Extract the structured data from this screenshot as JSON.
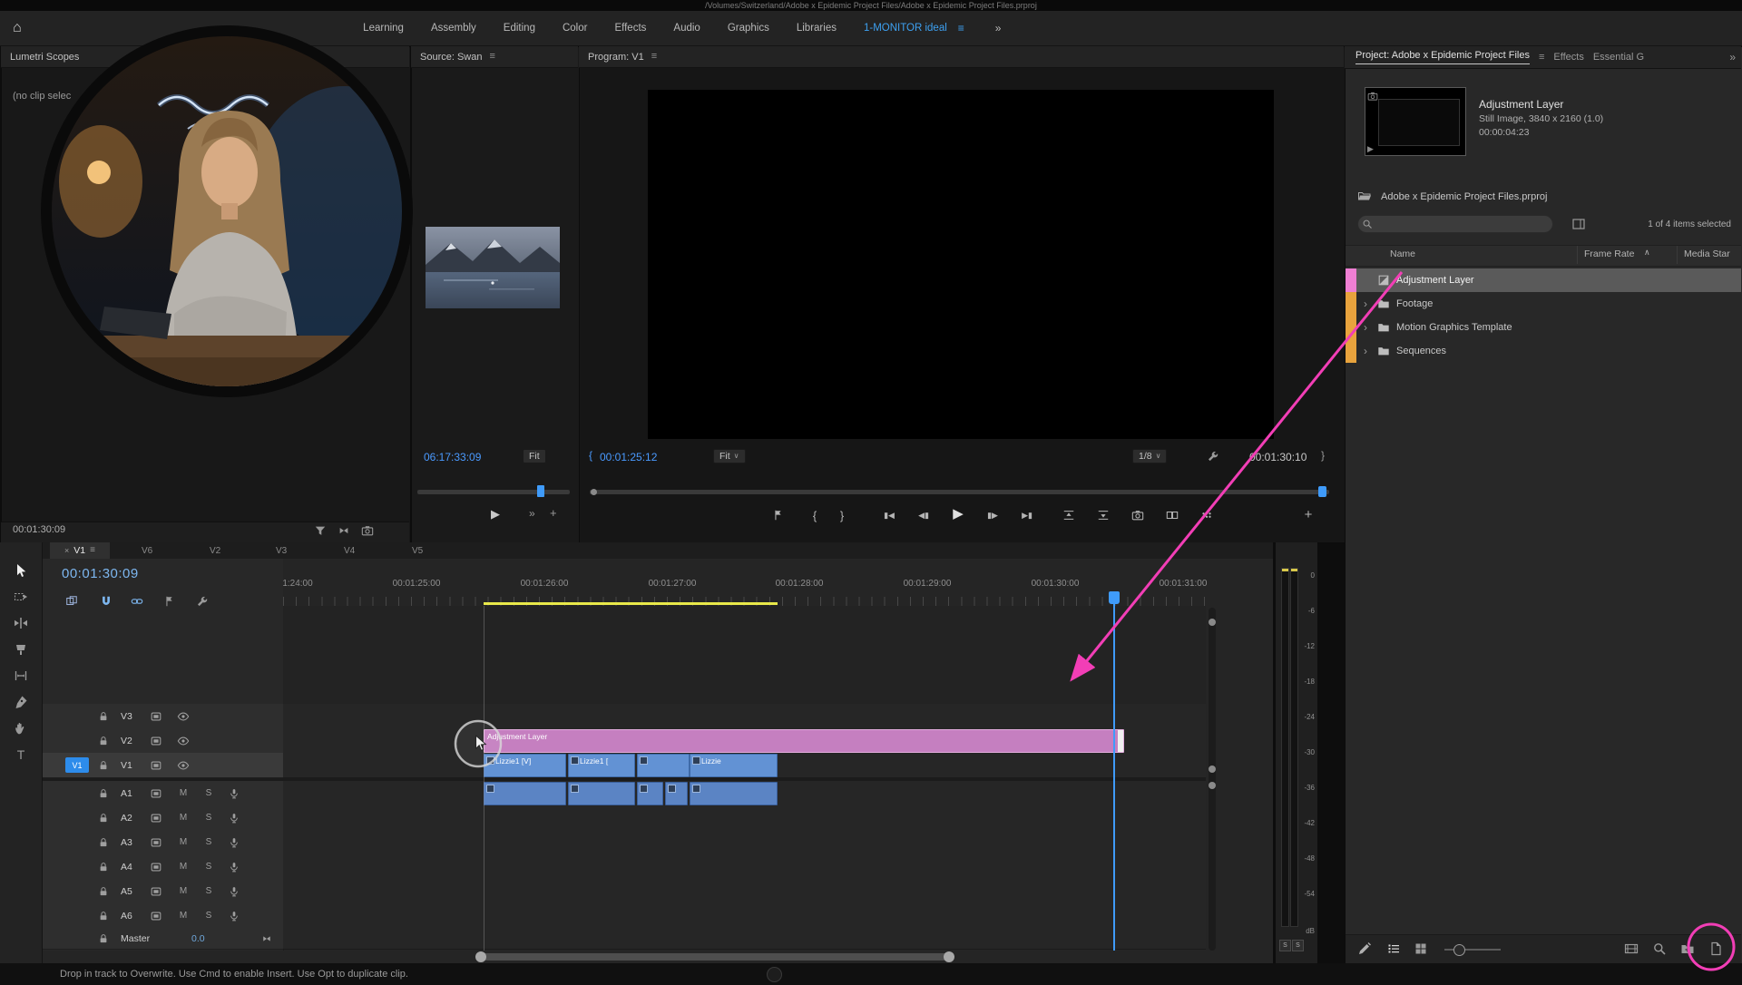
{
  "colors": {
    "accent_blue": "#3da0f0",
    "timecode_blue": "#4a9aff",
    "annotation_pink": "#f23eb6",
    "adjustment_clip_pink": "#c57fc0",
    "video_clip_blue": "#6292d4",
    "audio_clip_blue": "#5b84c4",
    "bin_label_pink": "#ef7fd3",
    "bin_label_orange": "#e8a33d",
    "work_bar_yellow": "#e8e84a",
    "selected_row_gray": "#5a5a5a"
  },
  "icons": {
    "home": "⌂",
    "menu": "≡",
    "overflow": "»",
    "close": "×",
    "chevron_right": "›",
    "caret_down": "∨",
    "sort_asc": "∧",
    "plus": "+",
    "play": "▶",
    "step_back": "◀▮",
    "step_forward": "▮▶",
    "go_to_in": "▮◀",
    "go_to_out": "▶▮",
    "brace_open": "{",
    "brace_close": "}",
    "type_tool": "T"
  },
  "titlebar": {
    "path": "/Volumes/Switzerland/Adobe x Epidemic Project Files/Adobe x Epidemic Project Files.prproj"
  },
  "workspaces": {
    "items": [
      "Learning",
      "Assembly",
      "Editing",
      "Color",
      "Effects",
      "Audio",
      "Graphics",
      "Libraries"
    ],
    "active": "1-MONITOR ideal"
  },
  "lumetri": {
    "title": "Lumetri Scopes",
    "empty_message": "(no clip selec",
    "timecode": "00:01:30:09"
  },
  "source": {
    "title": "Source: Swan",
    "timecode": "06:17:33:09",
    "fit_label": "Fit"
  },
  "program": {
    "title": "Program: V1",
    "timecode_current": "00:01:25:12",
    "fit_label": "Fit",
    "playback_resolution": "1/8",
    "timecode_end": "00:01:30:10"
  },
  "project": {
    "tab_project": "Project: Adobe x Epidemic Project Files",
    "tab_effects": "Effects",
    "tab_essential": "Essential G",
    "preview": {
      "name": "Adjustment Layer",
      "details": "Still Image, 3840 x 2160 (1.0)",
      "duration": "00:00:04:23"
    },
    "bin_path": "Adobe x Epidemic Project Files.prproj",
    "selection_status": "1 of 4 items selected",
    "columns": {
      "name": "Name",
      "frame_rate": "Frame Rate",
      "media_start": "Media Star"
    },
    "rows": [
      {
        "label": "Adjustment Layer"
      },
      {
        "label": "Footage"
      },
      {
        "label": "Motion Graphics Template"
      },
      {
        "label": "Sequences"
      }
    ]
  },
  "timeline": {
    "active_tab": "V1",
    "tabs": [
      "V6",
      "V2",
      "V3",
      "V4",
      "V5"
    ],
    "timecode": "00:01:30:09",
    "ruler_labels": [
      "1:24:00",
      "00:01:25:00",
      "00:01:26:00",
      "00:01:27:00",
      "00:01:28:00",
      "00:01:29:00",
      "00:01:30:00",
      "00:01:31:00"
    ],
    "video_tracks": [
      {
        "name": "V3"
      },
      {
        "name": "V2"
      },
      {
        "name": "V1",
        "patch": "V1"
      }
    ],
    "audio_tracks": [
      {
        "name": "A1"
      },
      {
        "name": "A2"
      },
      {
        "name": "A3"
      },
      {
        "name": "A4"
      },
      {
        "name": "A5"
      },
      {
        "name": "A6"
      }
    ],
    "mute_label": "M",
    "solo_label": "S",
    "master": {
      "name": "Master",
      "gain": "0.0"
    },
    "clips": {
      "adjustment_label": "Adjustment Layer",
      "v1_labels": [
        "Lizzie1 [V]",
        "Lizzie1 [",
        "",
        "Lizzie"
      ]
    }
  },
  "meters": {
    "ticks": [
      "0",
      "-6",
      "-12",
      "-18",
      "-24",
      "-30",
      "-36",
      "-42",
      "-48",
      "-54"
    ],
    "unit": "dB",
    "solo_label": "S"
  },
  "statusbar": {
    "message": "Drop in track to Overwrite. Use Cmd to enable Insert. Use Opt to duplicate clip."
  }
}
